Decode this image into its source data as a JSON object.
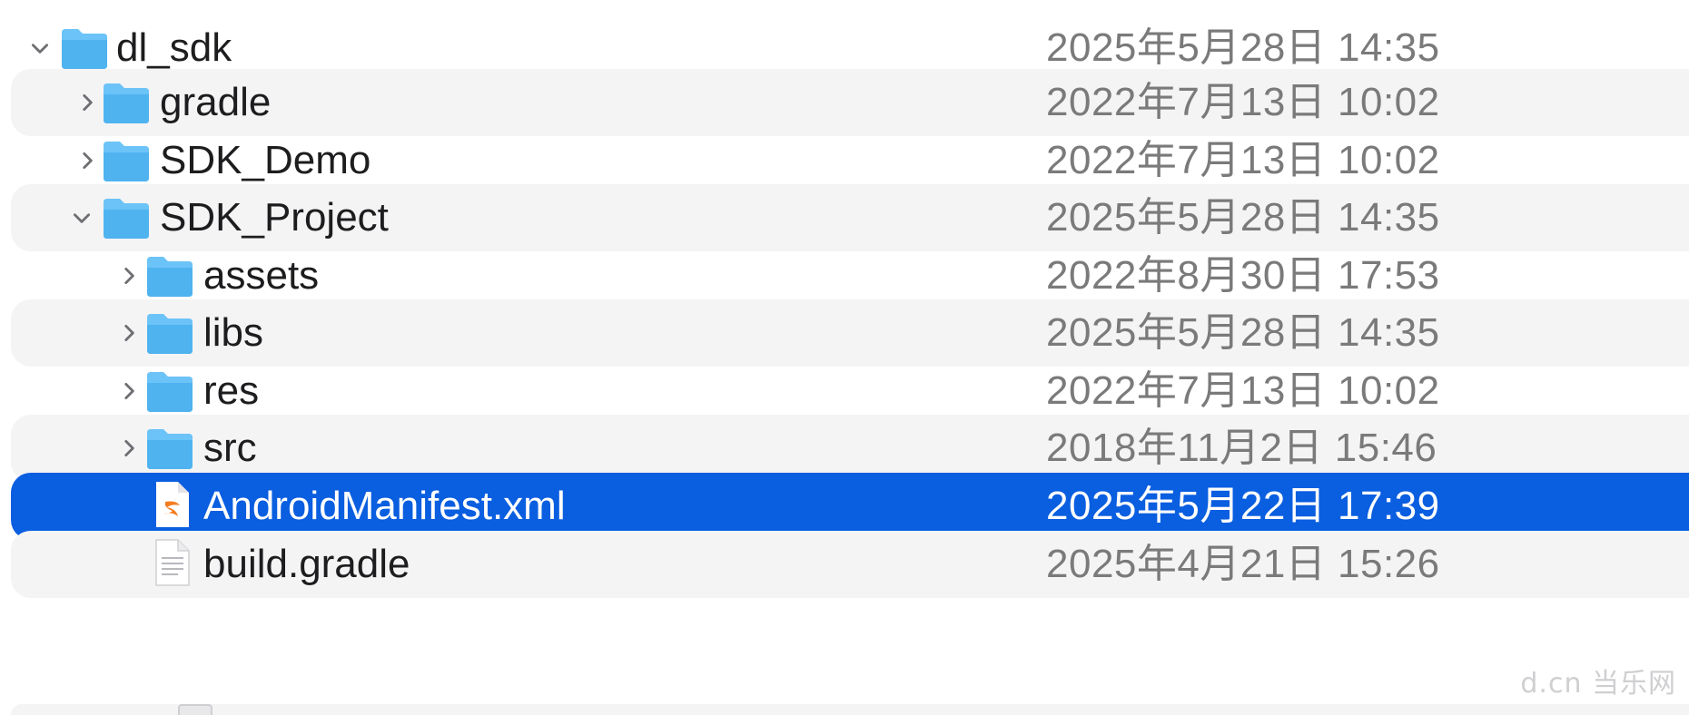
{
  "colors": {
    "selection": "#0a5ee0",
    "stripe": "#f4f4f5",
    "folder": "#4fb3f0",
    "date_text": "#7a7a7a",
    "swift_orange": "#f57c1f"
  },
  "rows": [
    {
      "name": "dl_sdk",
      "date": "2025年5月28日 14:35",
      "kind": "folder",
      "disclosure": "chevron-down-icon",
      "depth": 0
    },
    {
      "name": "gradle",
      "date": "2022年7月13日 10:02",
      "kind": "folder",
      "disclosure": "chevron-right-icon",
      "depth": 1
    },
    {
      "name": "SDK_Demo",
      "date": "2022年7月13日 10:02",
      "kind": "folder",
      "disclosure": "chevron-right-icon",
      "depth": 1
    },
    {
      "name": "SDK_Project",
      "date": "2025年5月28日 14:35",
      "kind": "folder",
      "disclosure": "chevron-down-icon",
      "depth": 1
    },
    {
      "name": "assets",
      "date": "2022年8月30日 17:53",
      "kind": "folder",
      "disclosure": "chevron-right-icon",
      "depth": 2
    },
    {
      "name": "libs",
      "date": "2025年5月28日 14:35",
      "kind": "folder",
      "disclosure": "chevron-right-icon",
      "depth": 2
    },
    {
      "name": "res",
      "date": "2022年7月13日 10:02",
      "kind": "folder",
      "disclosure": "chevron-right-icon",
      "depth": 2
    },
    {
      "name": "src",
      "date": "2018年11月2日 15:46",
      "kind": "folder",
      "disclosure": "chevron-right-icon",
      "depth": 2
    },
    {
      "name": "AndroidManifest.xml",
      "date": "2025年5月22日 17:39",
      "kind": "swift-file",
      "disclosure": "",
      "depth": 2,
      "selected": true
    },
    {
      "name": "build.gradle",
      "date": "2025年4月21日 15:26",
      "kind": "text-file",
      "disclosure": "",
      "depth": 2
    }
  ],
  "watermark": "d.cn 当乐网"
}
